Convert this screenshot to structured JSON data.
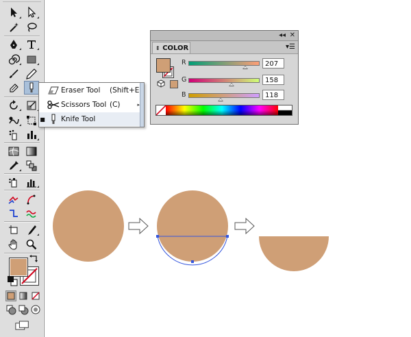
{
  "colors": {
    "shape_fill": "#cf9f76",
    "selection": "#3355dd",
    "panel_bg": "#d6d6d6",
    "none_slash": "#d0021b"
  },
  "toolbar": {
    "tools": [
      "selection-icon",
      "direct-selection-icon",
      "magic-wand-icon",
      "lasso-icon",
      "pen-icon",
      "type-icon",
      "spiral-icon",
      "rectangle-icon",
      "paintbrush-icon",
      "pencil-icon",
      "blob-brush-icon",
      "eraser-icon",
      "rotate-icon",
      "scale-icon",
      "warp-icon",
      "free-transform-icon",
      "symbol-sprayer-icon",
      "column-graph-icon",
      "mesh-icon",
      "gradient-icon",
      "eyedropper-icon",
      "blend-icon",
      "symbol-sprayer-alt-icon",
      "bar-graph-icon",
      "slice-icon",
      "scissors-swirl-icon",
      "artboard-icon",
      "slice-select-icon",
      "hand-icon",
      "zoom-icon"
    ]
  },
  "flyout": {
    "items": [
      {
        "label": "Eraser Tool",
        "shortcut": "(Shift+E)"
      },
      {
        "label": "Scissors Tool",
        "shortcut": "(C)"
      },
      {
        "label": "Knife Tool",
        "shortcut": ""
      }
    ],
    "selected_bullet": "■"
  },
  "color_panel": {
    "tab_label": "COLOR",
    "channels": [
      {
        "label": "R",
        "value": "207",
        "fraction": 0.81
      },
      {
        "label": "G",
        "value": "158",
        "fraction": 0.62
      },
      {
        "label": "B",
        "value": "118",
        "fraction": 0.46
      }
    ]
  }
}
